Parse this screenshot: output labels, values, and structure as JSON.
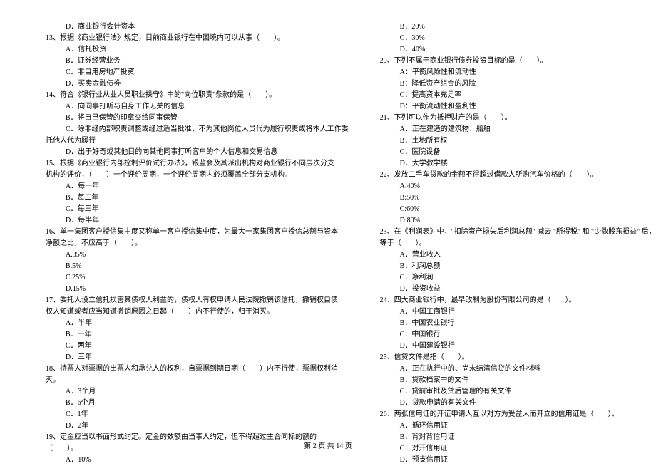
{
  "left": [
    {
      "cls": "indent-2",
      "t": "D．商业银行会计资本"
    },
    {
      "cls": "indent-q",
      "t": "13、根据《商业银行法》规定，目前商业银行在中国境内可以从事（　　）。"
    },
    {
      "cls": "indent-2",
      "t": "A．信托投资"
    },
    {
      "cls": "indent-2",
      "t": "B．证券经营业务"
    },
    {
      "cls": "indent-2",
      "t": "C．非自用房地产投资"
    },
    {
      "cls": "indent-2",
      "t": "D．买卖金融债券"
    },
    {
      "cls": "indent-q",
      "t": "14、符合《银行业从业人员职业操守》中的\"岗位职责\"条款的是（　　）。"
    },
    {
      "cls": "indent-2",
      "t": "A．向同事打听与自身工作无关的信息"
    },
    {
      "cls": "indent-2",
      "t": "B．将自己保管的印章交给同事保管"
    },
    {
      "cls": "indent-2",
      "t": "C．除非经内部职责调整或经过适当批准，不为其他岗位人员代为履行职责或将本人工作委"
    },
    {
      "cls": "indent-q",
      "t": "托他人代为履行"
    },
    {
      "cls": "indent-2",
      "t": "D．出于好奇或其他目的向其他同事打听客户的个人信息和交易信息"
    },
    {
      "cls": "indent-q",
      "t": "15、根据《商业银行内部控制评价试行办法》，银监会及其派出机构对商业银行不同层次分支"
    },
    {
      "cls": "indent-q",
      "t": "机构的评价，（　　）一个评价周期，一个评价周期内必须覆盖全部分支机构。"
    },
    {
      "cls": "indent-2",
      "t": "A．每一年"
    },
    {
      "cls": "indent-2",
      "t": "B．每二年"
    },
    {
      "cls": "indent-2",
      "t": "C．每三年"
    },
    {
      "cls": "indent-2",
      "t": "D．每半年"
    },
    {
      "cls": "indent-q",
      "t": "16、单一集团客户授信集中度又称单一客户授信集中度，为最大一家集团客户授信总额与资本"
    },
    {
      "cls": "indent-q",
      "t": "净额之比，不应高于（　　）。"
    },
    {
      "cls": "indent-2",
      "t": "A.35%"
    },
    {
      "cls": "indent-2",
      "t": "B.5%"
    },
    {
      "cls": "indent-2",
      "t": "C.25%"
    },
    {
      "cls": "indent-2",
      "t": "D.15%"
    },
    {
      "cls": "indent-q",
      "t": "17、委托人设立信托损害其债权人利益的，债权人有权申请人民法院撤销该信托，撤销权自债"
    },
    {
      "cls": "indent-q",
      "t": "权人知道或者应当知道撤销原因之日起（　　）内不行使的，归于消灭。"
    },
    {
      "cls": "indent-2",
      "t": "A．半年"
    },
    {
      "cls": "indent-2",
      "t": "B．一年"
    },
    {
      "cls": "indent-2",
      "t": "C．两年"
    },
    {
      "cls": "indent-2",
      "t": "D．三年"
    },
    {
      "cls": "indent-q",
      "t": "18、持票人对票据的出票人和承兑人的权利，自票据到期日期（　　）内不行使，票据权利消"
    },
    {
      "cls": "indent-q",
      "t": "灭。"
    },
    {
      "cls": "indent-2",
      "t": "A．3个月"
    },
    {
      "cls": "indent-2",
      "t": "B．6个月"
    },
    {
      "cls": "indent-2",
      "t": "C．1年"
    },
    {
      "cls": "indent-2",
      "t": "D．2年"
    },
    {
      "cls": "indent-q",
      "t": "19、定金应当以书面形式约定。定金的数额由当事人约定，但不得超过主合同标的额的"
    },
    {
      "cls": "indent-q",
      "t": "（　　）。"
    },
    {
      "cls": "indent-2",
      "t": "A．10%"
    }
  ],
  "right": [
    {
      "cls": "indent-2",
      "t": "B．20%"
    },
    {
      "cls": "indent-2",
      "t": "C．30%"
    },
    {
      "cls": "indent-2",
      "t": "D．40%"
    },
    {
      "cls": "indent-q",
      "t": "20、下列不属于商业银行债券投资目标的是（　　）。"
    },
    {
      "cls": "indent-2",
      "t": "A：平衡风险性和流动性"
    },
    {
      "cls": "indent-2",
      "t": "B：降低资产组合的风险"
    },
    {
      "cls": "indent-2",
      "t": "C：提高资本充足率"
    },
    {
      "cls": "indent-2",
      "t": "D：平衡流动性和盈利性"
    },
    {
      "cls": "indent-q",
      "t": "21、下列可以作为抵押财产的是（　　）。"
    },
    {
      "cls": "indent-2",
      "t": "A．正在建造的建筑物、船舶"
    },
    {
      "cls": "indent-2",
      "t": "B．土地所有权"
    },
    {
      "cls": "indent-2",
      "t": "C．医院设备"
    },
    {
      "cls": "indent-2",
      "t": "D．大学教学楼"
    },
    {
      "cls": "indent-q",
      "t": "22、发放二手车贷款的金额不得超过借款人所购汽车价格的（　　）。"
    },
    {
      "cls": "indent-2",
      "t": "A:40%"
    },
    {
      "cls": "indent-2",
      "t": "B:50%"
    },
    {
      "cls": "indent-2",
      "t": "C:60%"
    },
    {
      "cls": "indent-2",
      "t": "D:80%"
    },
    {
      "cls": "indent-q",
      "t": "23、在《利润表》中，\"扣除资产损失后利润总额\" 减去 \"所得税\" 和 \"少数股东损益\" 后，"
    },
    {
      "cls": "indent-q",
      "t": "等于（　　）。"
    },
    {
      "cls": "indent-2",
      "t": "A．营业收入"
    },
    {
      "cls": "indent-2",
      "t": "B．利润总额"
    },
    {
      "cls": "indent-2",
      "t": "C．净利润"
    },
    {
      "cls": "indent-2",
      "t": "D．投资收益"
    },
    {
      "cls": "indent-q",
      "t": "24、四大商业银行中，最早改制为股份有限公司的是（　　）。"
    },
    {
      "cls": "indent-2",
      "t": "A．中国工商银行"
    },
    {
      "cls": "indent-2",
      "t": "B．中国农业银行"
    },
    {
      "cls": "indent-2",
      "t": "C．中国银行"
    },
    {
      "cls": "indent-2",
      "t": "D．中国建设银行"
    },
    {
      "cls": "indent-q",
      "t": "25、信贷文件是指（　　）。"
    },
    {
      "cls": "indent-2",
      "t": "A．正在执行中的、尚未结清信贷的文件材料"
    },
    {
      "cls": "indent-2",
      "t": "B．贷款档案中的文件"
    },
    {
      "cls": "indent-2",
      "t": "C．贷前审批及贷后管理的有关文件"
    },
    {
      "cls": "indent-2",
      "t": "D．贷款申请的有关文件"
    },
    {
      "cls": "indent-q",
      "t": "26、两张信用证的开证申请人互以对方为受益人而开立的信用证是（　　）。"
    },
    {
      "cls": "indent-2",
      "t": "A．循环信用证"
    },
    {
      "cls": "indent-2",
      "t": "B．背对背信用证"
    },
    {
      "cls": "indent-2",
      "t": "C．对开信用证"
    },
    {
      "cls": "indent-2",
      "t": "D．预支信用证"
    }
  ],
  "footer": "第 2 页 共 14 页"
}
